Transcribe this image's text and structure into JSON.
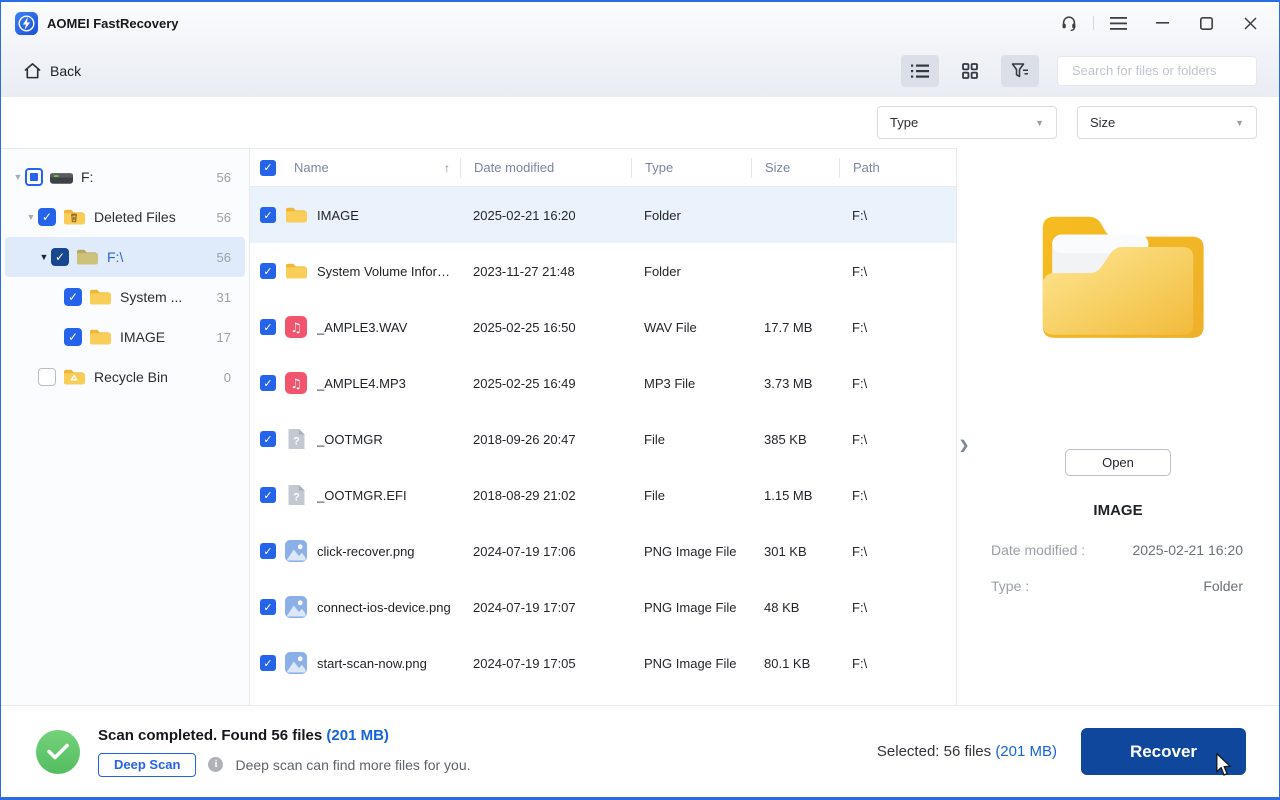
{
  "window": {
    "title": "AOMEI FastRecovery"
  },
  "toolbar": {
    "back_label": "Back",
    "search_placeholder": "Search for files or folders"
  },
  "filters": {
    "type_label": "Type",
    "size_label": "Size"
  },
  "sidebar": {
    "items": [
      {
        "label": "F:",
        "count": "56",
        "level": 0,
        "checkbox": "partial",
        "icon": "drive-icon",
        "arrow": "gray",
        "selected": false
      },
      {
        "label": "Deleted Files",
        "count": "56",
        "level": 1,
        "checkbox": "checked",
        "icon": "folder-deleted-icon",
        "arrow": "gray",
        "selected": false
      },
      {
        "label": "F:\\",
        "count": "56",
        "level": 2,
        "checkbox": "checked-dark",
        "icon": "folder-open-icon",
        "arrow": "dark",
        "selected": true
      },
      {
        "label": "System ...",
        "count": "31",
        "level": 3,
        "checkbox": "checked",
        "icon": "folder-icon",
        "arrow": "none",
        "selected": false
      },
      {
        "label": "IMAGE",
        "count": "17",
        "level": 3,
        "checkbox": "checked",
        "icon": "folder-icon",
        "arrow": "none",
        "selected": false
      },
      {
        "label": "Recycle Bin",
        "count": "0",
        "level": 1,
        "checkbox": "unchecked",
        "icon": "folder-recycle-icon",
        "arrow": "none",
        "selected": false
      }
    ]
  },
  "table": {
    "columns": {
      "name": "Name",
      "date": "Date modified",
      "type": "Type",
      "size": "Size",
      "path": "Path"
    },
    "sort_icon": "up-arrow",
    "rows": [
      {
        "name": "IMAGE",
        "date": "2025-02-21 16:20",
        "type": "Folder",
        "size": "",
        "path": "F:\\",
        "icon": "folder-icon",
        "selected": true
      },
      {
        "name": "System Volume Informati...",
        "date": "2023-11-27 21:48",
        "type": "Folder",
        "size": "",
        "path": "F:\\",
        "icon": "folder-icon",
        "selected": false
      },
      {
        "name": "_AMPLE3.WAV",
        "date": "2025-02-25 16:50",
        "type": "WAV File",
        "size": "17.7 MB",
        "path": "F:\\",
        "icon": "audio-file-icon",
        "selected": false
      },
      {
        "name": "_AMPLE4.MP3",
        "date": "2025-02-25 16:49",
        "type": "MP3 File",
        "size": "3.73 MB",
        "path": "F:\\",
        "icon": "audio-file-icon",
        "selected": false
      },
      {
        "name": "_OOTMGR",
        "date": "2018-09-26 20:47",
        "type": "File",
        "size": "385 KB",
        "path": "F:\\",
        "icon": "unknown-file-icon",
        "selected": false
      },
      {
        "name": "_OOTMGR.EFI",
        "date": "2018-08-29 21:02",
        "type": "File",
        "size": "1.15 MB",
        "path": "F:\\",
        "icon": "unknown-file-icon",
        "selected": false
      },
      {
        "name": "click-recover.png",
        "date": "2024-07-19 17:06",
        "type": "PNG Image File",
        "size": "301 KB",
        "path": "F:\\",
        "icon": "image-file-icon",
        "selected": false
      },
      {
        "name": "connect-ios-device.png",
        "date": "2024-07-19 17:07",
        "type": "PNG Image File",
        "size": "48 KB",
        "path": "F:\\",
        "icon": "image-file-icon",
        "selected": false
      },
      {
        "name": "start-scan-now.png",
        "date": "2024-07-19 17:05",
        "type": "PNG Image File",
        "size": "80.1 KB",
        "path": "F:\\",
        "icon": "image-file-icon",
        "selected": false
      }
    ]
  },
  "preview": {
    "open_label": "Open",
    "title": "IMAGE",
    "fields": [
      {
        "label": "Date modified :",
        "value": "2025-02-21 16:20"
      },
      {
        "label": "Type :",
        "value": "Folder"
      }
    ]
  },
  "statusbar": {
    "scan_text": "Scan completed. Found 56 files ",
    "scan_size": "(201 MB)",
    "deep_scan_label": "Deep Scan",
    "deep_scan_hint": "Deep scan can find more files for you.",
    "selected_text": "Selected: 56 files ",
    "selected_size": "(201 MB)",
    "recover_label": "Recover"
  },
  "colors": {
    "accent": "#2b6be4",
    "checkbox_blue": "#2563eb",
    "link_blue": "#1565d8",
    "recover_bg": "#0e479c",
    "success_green": "#5fc86a",
    "selected_row_bg": "#eaf2fb"
  }
}
